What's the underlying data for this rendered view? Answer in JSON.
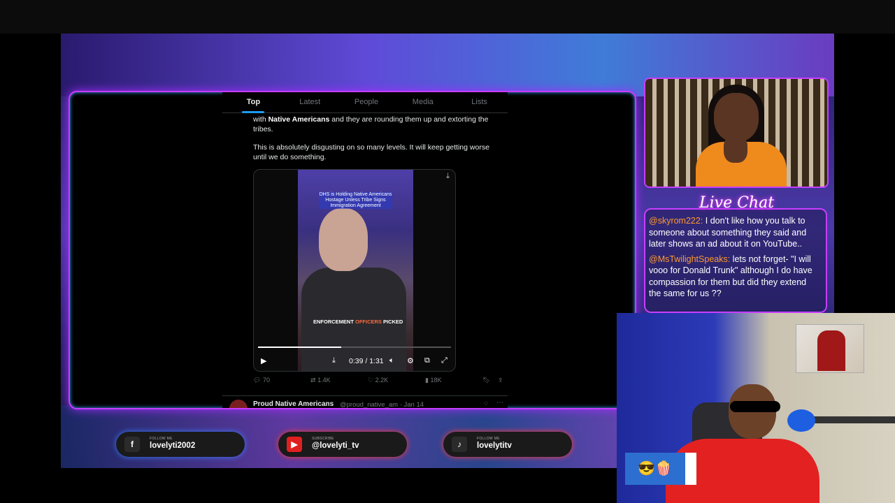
{
  "feed": {
    "tabs": [
      {
        "label": "Top",
        "active": true
      },
      {
        "label": "Latest",
        "active": false
      },
      {
        "label": "People",
        "active": false
      },
      {
        "label": "Media",
        "active": false
      },
      {
        "label": "Lists",
        "active": false
      }
    ],
    "tweet_text_prefix": "with ",
    "tweet_text_bold": "Native Americans",
    "tweet_text_rest": " and they are rounding them up and extorting the tribes.",
    "tweet_text_2": "This is absolutely disgusting on so many levels. It will keep getting worse until we do something.",
    "video": {
      "caption_top": "DHS is Holding Native Americans Hostage Unless Tribe Signs Immigration Agreement",
      "caption_bottom_1": "ENFORCEMENT ",
      "caption_bottom_2": "OFFICERS",
      "caption_bottom_3": " PICKED",
      "time": "0:39 / 1:31",
      "progress": 0.43
    },
    "stats": {
      "replies": "70",
      "retweets": "1.4K",
      "likes": "2.2K",
      "views": "18K"
    },
    "next_tweet": {
      "name": "Proud Native Americans",
      "handle": "@proud_native_am · Jan 14"
    }
  },
  "socials": [
    {
      "icon": "facebook-icon",
      "glyph": "f",
      "caption": "FOLLOW ME",
      "name": "lovelyti2002",
      "color": "#2b2b2b"
    },
    {
      "icon": "youtube-icon",
      "glyph": "▶",
      "caption": "SUBSCRIBE",
      "name": "@lovelyti_tv",
      "color": "#e02020"
    },
    {
      "icon": "tiktok-icon",
      "glyph": "♪",
      "caption": "FOLLOW ME",
      "name": "lovelytitv",
      "color": "#2b2b2b"
    }
  ],
  "chat": {
    "title": "Live Chat",
    "messages": [
      {
        "user": "@skyrom222:",
        "text": " I don't like how you talk to someone about something they said and later shows an ad about it on YouTube.."
      },
      {
        "user": "@MsTwilightSpeaks:",
        "text": " lets not forget- \"I will vooo for Donald Trunk\" although I do have compassion for them but did they extend the same for us ??"
      }
    ]
  },
  "emoji_box": "😎🍿"
}
